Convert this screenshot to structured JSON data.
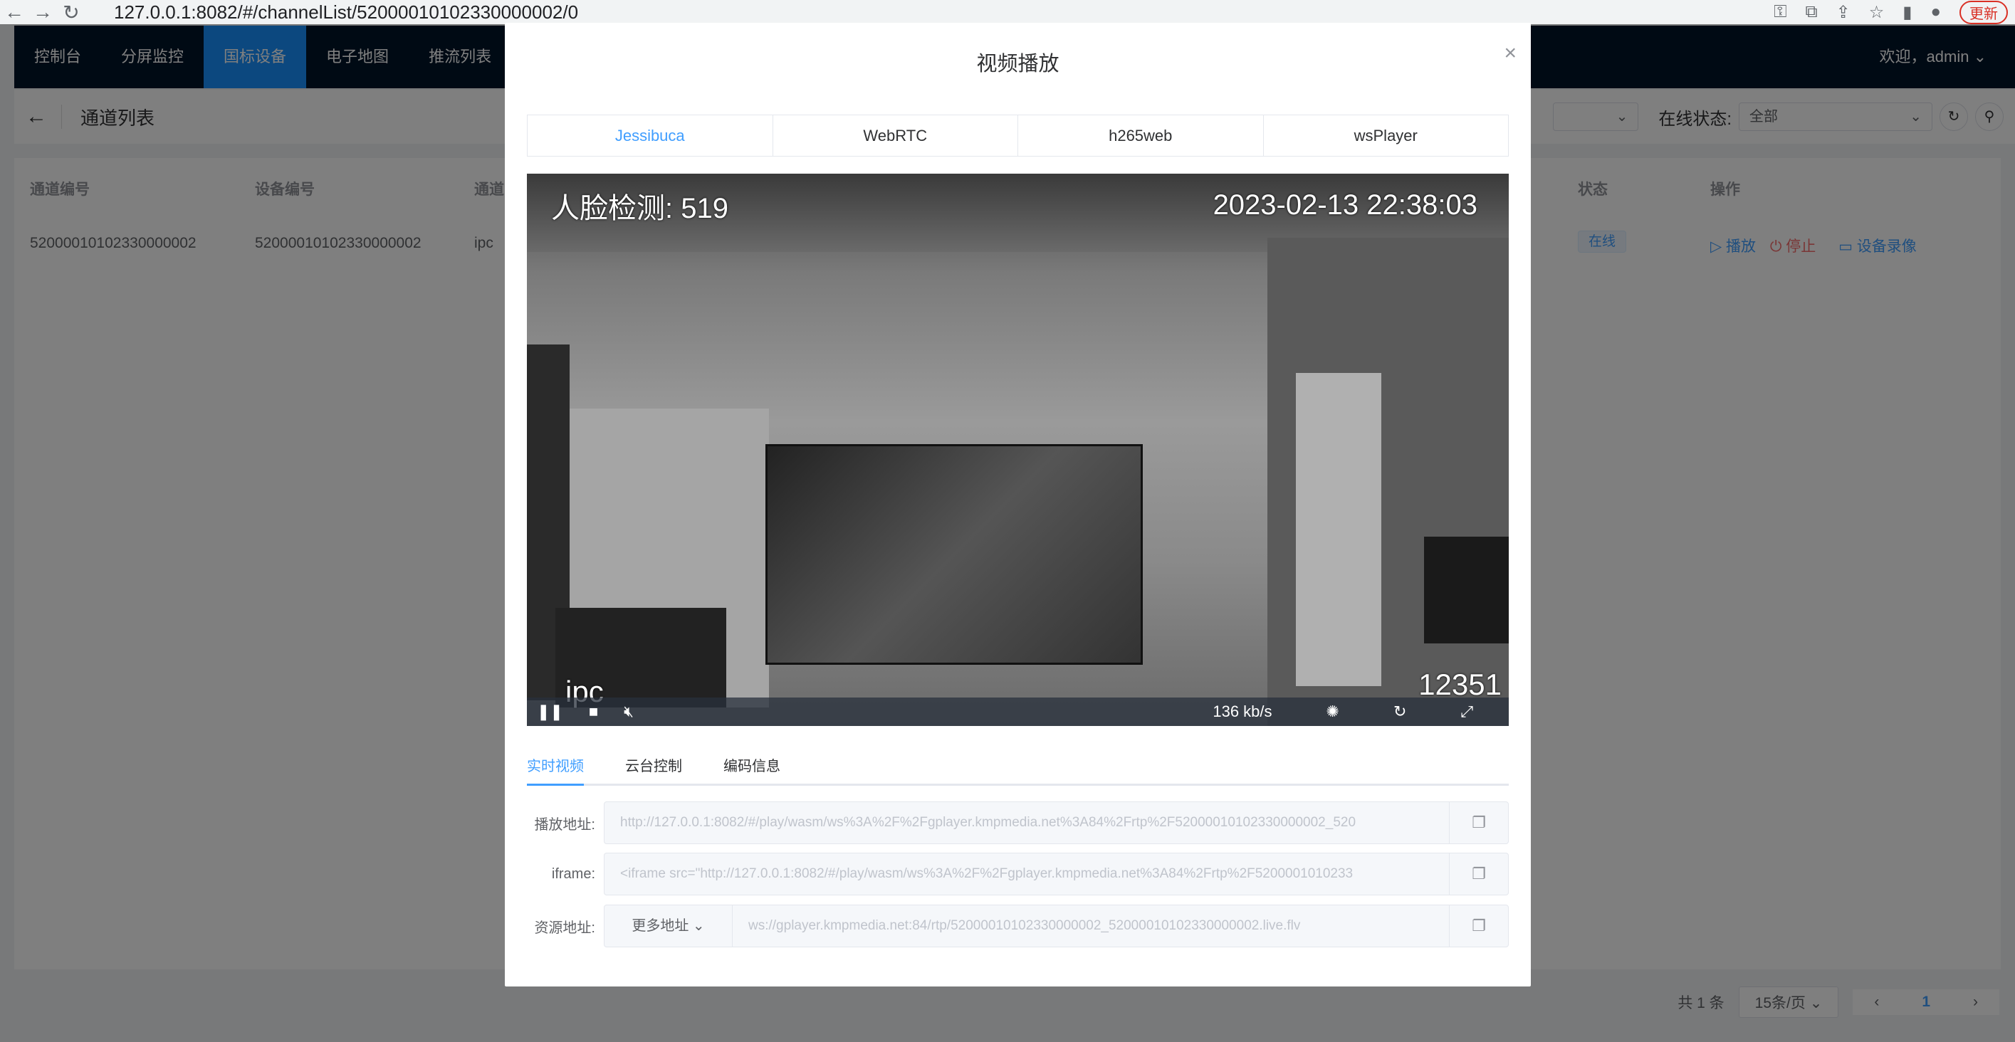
{
  "browser": {
    "url": "127.0.0.1:8082/#/channelList/52000010102330000002/0",
    "update_label": "更新"
  },
  "nav": {
    "items": [
      "控制台",
      "分屏监控",
      "国标设备",
      "电子地图",
      "推流列表"
    ],
    "active": 2,
    "welcome": "欢迎，admin"
  },
  "page": {
    "title": "通道列表",
    "status_filter_label": "在线状态:",
    "status_filter_value": "全部"
  },
  "table": {
    "headers": {
      "channel_id": "通道编号",
      "device_id": "设备编号",
      "channel_name": "通道",
      "status": "状态",
      "actions": "操作"
    },
    "rows": [
      {
        "channel_id": "52000010102330000002",
        "device_id": "52000010102330000002",
        "channel_name": "ipc",
        "status": "在线",
        "play": "播放",
        "stop": "停止",
        "record": "设备录像"
      }
    ]
  },
  "pagination": {
    "total": "共 1 条",
    "page_size": "15条/页",
    "current": "1"
  },
  "modal": {
    "title": "视频播放",
    "player_tabs": [
      "Jessibuca",
      "WebRTC",
      "h265web",
      "wsPlayer"
    ],
    "active_player_tab": 0,
    "video": {
      "osd_face": "人脸检测: 519",
      "osd_time": "2023-02-13 22:38:03",
      "osd_name": "ipc",
      "osd_counter": "12351",
      "bitrate": "136 kb/s"
    },
    "sub_tabs": [
      "实时视频",
      "云台控制",
      "编码信息"
    ],
    "active_sub_tab": 0,
    "fields": {
      "play_label": "播放地址:",
      "play_value": "http://127.0.0.1:8082/#/play/wasm/ws%3A%2F%2Fgplayer.kmpmedia.net%3A84%2Frtp%2F52000010102330000002_520",
      "iframe_label": "iframe:",
      "iframe_value": "<iframe src=\"http://127.0.0.1:8082/#/play/wasm/ws%3A%2F%2Fgplayer.kmpmedia.net%3A84%2Frtp%2F5200001010233",
      "source_label": "资源地址:",
      "source_more": "更多地址",
      "source_value": "ws://gplayer.kmpmedia.net:84/rtp/52000010102330000002_52000010102330000002.live.flv"
    }
  }
}
